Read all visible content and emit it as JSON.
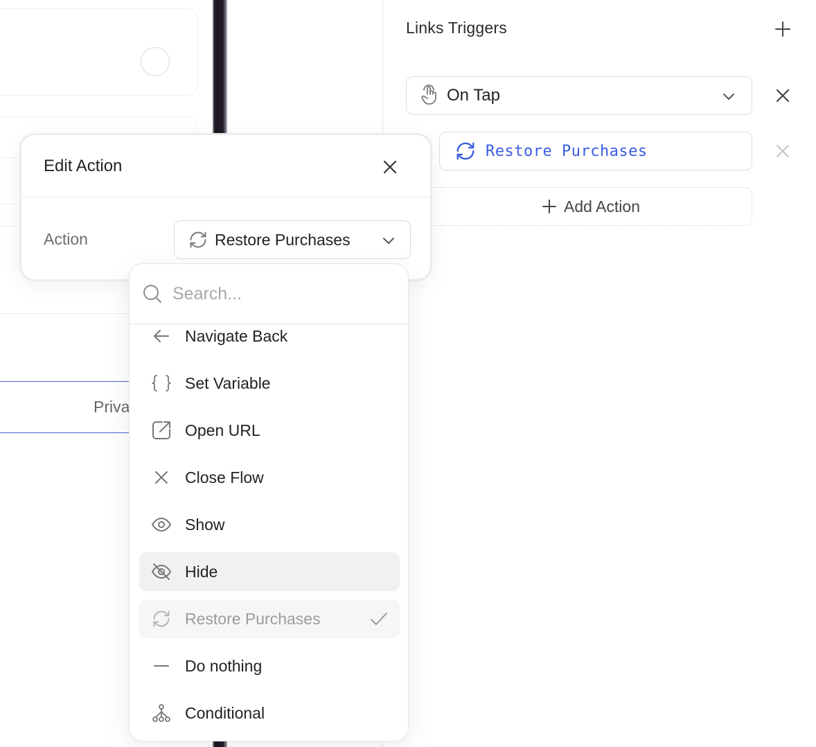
{
  "canvas": {
    "privacy_text": "Privacy"
  },
  "right_panel": {
    "title": "Links Triggers",
    "trigger": {
      "label": "On Tap",
      "icon": "tap-gesture-icon"
    },
    "action": {
      "label": "Restore Purchases",
      "icon": "refresh-icon",
      "color": "#3a5ce0"
    },
    "add_action_label": "Add Action"
  },
  "edit_action": {
    "title": "Edit Action",
    "field_label": "Action",
    "selected_value": "Restore Purchases"
  },
  "dropdown": {
    "search_placeholder": "Search...",
    "items": [
      {
        "label": "Navigate Back",
        "icon": "arrow-left-icon",
        "state": "normal"
      },
      {
        "label": "Set Variable",
        "icon": "braces-icon",
        "state": "normal"
      },
      {
        "label": "Open URL",
        "icon": "external-link-icon",
        "state": "normal"
      },
      {
        "label": "Close Flow",
        "icon": "close-icon",
        "state": "normal"
      },
      {
        "label": "Show",
        "icon": "eye-icon",
        "state": "normal"
      },
      {
        "label": "Hide",
        "icon": "eye-off-icon",
        "state": "hovered"
      },
      {
        "label": "Restore Purchases",
        "icon": "refresh-icon",
        "state": "selected"
      },
      {
        "label": "Do nothing",
        "icon": "minus-icon",
        "state": "normal"
      },
      {
        "label": "Conditional",
        "icon": "branch-icon",
        "state": "normal"
      }
    ]
  }
}
